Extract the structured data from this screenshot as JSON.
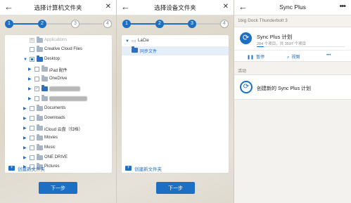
{
  "panel1": {
    "title": "选择计算机文件夹",
    "back_icon": "arrow-left-icon",
    "close_icon": "close-icon",
    "steps": [
      "1",
      "2",
      "3",
      "4"
    ],
    "active_step": 2,
    "rows": [
      {
        "label": "Applications",
        "state": "disabled",
        "expand": false
      },
      {
        "label": "Creative Cloud Files",
        "state": "unchecked",
        "expand": false
      },
      {
        "label": "Desktop",
        "state": "partial",
        "expand": true
      },
      {
        "label": "iPad 配件",
        "state": "unchecked",
        "expand": false
      },
      {
        "label": "OneDrive",
        "state": "unchecked",
        "expand": false
      },
      {
        "label": "",
        "state": "checked",
        "expand": false
      },
      {
        "label": "",
        "state": "unchecked",
        "expand": false
      },
      {
        "label": "Documents",
        "state": "unchecked",
        "expand": false
      },
      {
        "label": "Downloads",
        "state": "unchecked",
        "expand": false
      },
      {
        "label": "iCloud 云盘（归档）",
        "state": "unchecked",
        "expand": false
      },
      {
        "label": "Movies",
        "state": "unchecked",
        "expand": false
      },
      {
        "label": "Music",
        "state": "unchecked",
        "expand": false
      },
      {
        "label": "ONE DRIVE",
        "state": "unchecked",
        "expand": false
      },
      {
        "label": "Pictures",
        "state": "unchecked",
        "expand": false
      }
    ],
    "new_folder": "创建新文件夹",
    "next": "下一步"
  },
  "panel2": {
    "title": "选择设备文件夹",
    "back_icon": "arrow-left-icon",
    "close_icon": "close-icon",
    "steps": [
      "1",
      "2",
      "3",
      "4"
    ],
    "active_step": 3,
    "drive": "LaCie",
    "folder": "同步文件",
    "new_folder": "创建新文件夹",
    "next": "下一步"
  },
  "panel3": {
    "title": "Sync Plus",
    "back_icon": "arrow-left-icon",
    "more_icon": "more-dots-icon",
    "device": "1big Dock Thunderbolt 3",
    "plan_name": "Sync Plus 计划",
    "plan_status": "284 个项目，共 3597 个项目",
    "progress": 0.08,
    "actions": {
      "pause": "暂停",
      "view": "视图",
      "more": "•••"
    },
    "section": "活动",
    "create": "创建新的 Sync Plus 计划"
  },
  "colors": {
    "accent": "#1d6fc4"
  }
}
